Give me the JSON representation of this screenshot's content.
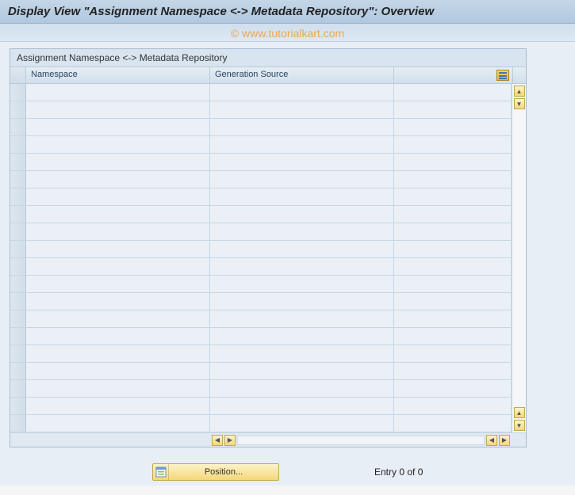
{
  "title": "Display View \"Assignment Namespace <-> Metadata Repository\": Overview",
  "watermark": "© www.tutorialkart.com",
  "panel": {
    "title": "Assignment Namespace <-> Metadata Repository",
    "columns": {
      "namespace": "Namespace",
      "gensource": "Generation Source"
    },
    "rows": [
      {
        "namespace": "",
        "gensource": ""
      },
      {
        "namespace": "",
        "gensource": ""
      },
      {
        "namespace": "",
        "gensource": ""
      },
      {
        "namespace": "",
        "gensource": ""
      },
      {
        "namespace": "",
        "gensource": ""
      },
      {
        "namespace": "",
        "gensource": ""
      },
      {
        "namespace": "",
        "gensource": ""
      },
      {
        "namespace": "",
        "gensource": ""
      },
      {
        "namespace": "",
        "gensource": ""
      },
      {
        "namespace": "",
        "gensource": ""
      },
      {
        "namespace": "",
        "gensource": ""
      },
      {
        "namespace": "",
        "gensource": ""
      },
      {
        "namespace": "",
        "gensource": ""
      },
      {
        "namespace": "",
        "gensource": ""
      },
      {
        "namespace": "",
        "gensource": ""
      },
      {
        "namespace": "",
        "gensource": ""
      },
      {
        "namespace": "",
        "gensource": ""
      },
      {
        "namespace": "",
        "gensource": ""
      },
      {
        "namespace": "",
        "gensource": ""
      },
      {
        "namespace": "",
        "gensource": ""
      }
    ]
  },
  "footer": {
    "position_label": "Position...",
    "entry_text": "Entry 0 of 0"
  },
  "icons": {
    "config": "table-config-icon",
    "up": "▲",
    "down": "▼",
    "left": "◀",
    "right": "▶"
  }
}
